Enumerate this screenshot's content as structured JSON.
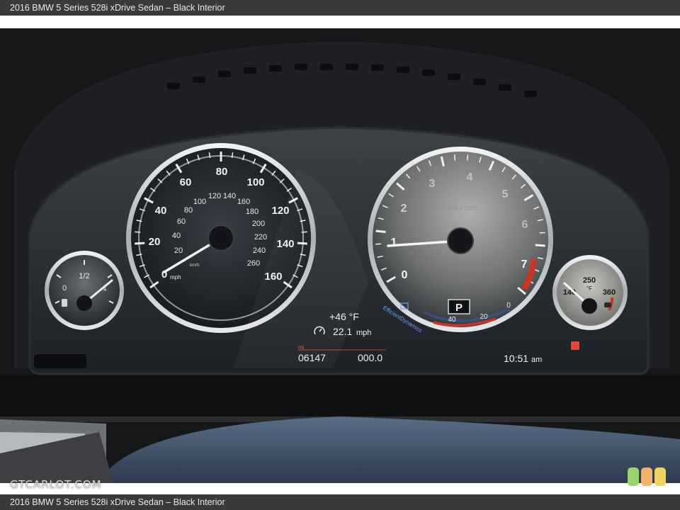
{
  "caption": "2016 BMW 5 Series 528i xDrive Sedan – Black Interior",
  "watermark": "GTCARLOT.COM",
  "speedometer": {
    "outer_labels": [
      "0",
      "20",
      "40",
      "60",
      "80",
      "100",
      "120",
      "140",
      "160"
    ],
    "inner_labels": [
      "20",
      "40",
      "60",
      "80",
      "100",
      "120",
      "140",
      "160",
      "180",
      "200",
      "220",
      "240",
      "260"
    ],
    "unit_outer": "mph",
    "unit_inner": "km/h"
  },
  "tachometer": {
    "labels": [
      "0",
      "1",
      "2",
      "3",
      "4",
      "5",
      "6",
      "7"
    ],
    "multiplier": "1/min x 1000",
    "brand_text": "EfficientDynamics",
    "eco_labels": [
      "40",
      "20",
      "0"
    ],
    "gear": "P"
  },
  "fuel_gauge": {
    "labels": [
      "0",
      "1/2",
      "1"
    ]
  },
  "oil_gauge": {
    "labels": [
      "140",
      "250",
      "360"
    ],
    "unit": "°F"
  },
  "info": {
    "temperature": "+46 °F",
    "speed_icon": "speedometer-icon",
    "speed_value": "22.1",
    "speed_unit": "mph",
    "distance_unit": "mi",
    "odometer": "06147",
    "trip": "000.0",
    "clock": "10:51",
    "clock_suffix": "am"
  },
  "colors": {
    "redline": "#d2321f",
    "chrome": "#d9dde0",
    "dial_face": "#23272c",
    "text": "#f1f1f1",
    "blue": "#5aa6ff"
  }
}
